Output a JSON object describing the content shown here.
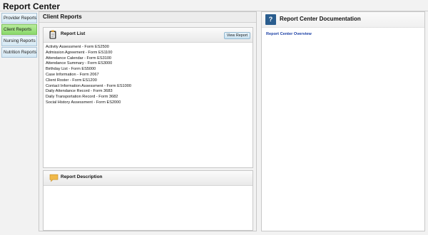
{
  "app": {
    "title": "Report Center"
  },
  "sidebar": {
    "tabs": [
      {
        "label": "Provider Reports",
        "active": false
      },
      {
        "label": "Client Reports",
        "active": true
      },
      {
        "label": "Nursing Reports",
        "active": false
      },
      {
        "label": "Nutrition Reports",
        "active": false
      }
    ]
  },
  "client_panel": {
    "title": "Client Reports",
    "report_list": {
      "title": "Report List",
      "view_button": "View Report",
      "items": [
        "Activity Assessment - Form ES2500",
        "Admission Agreement - Form ES1100",
        "Attendance Calendar - Form ES3100",
        "Attendance Summary - Form ES3000",
        "Birthday List - Form ES5000",
        "Case Information - Form 2067",
        "Client Roster - Form ES1200",
        "Contact Information Assessment - Form ES1000",
        "Daily Attendance Record - Form 3683",
        "Daily Transportation Record - Form 3682",
        "Social History Assessment - Form ES2000"
      ]
    },
    "report_description": {
      "title": "Report Description"
    }
  },
  "doc_panel": {
    "title": "Report Center Documentation",
    "link": "Report Center Overview"
  },
  "colors": {
    "active_tab": "#89d86a",
    "tab": "#d4e8f4",
    "help_icon": "#2a5d8e",
    "link": "#1a3fa5",
    "description_icon": "#f0b94a"
  },
  "icons": {
    "help": "question-mark",
    "report_list": "clipboard",
    "report_description": "speech-bubble"
  }
}
